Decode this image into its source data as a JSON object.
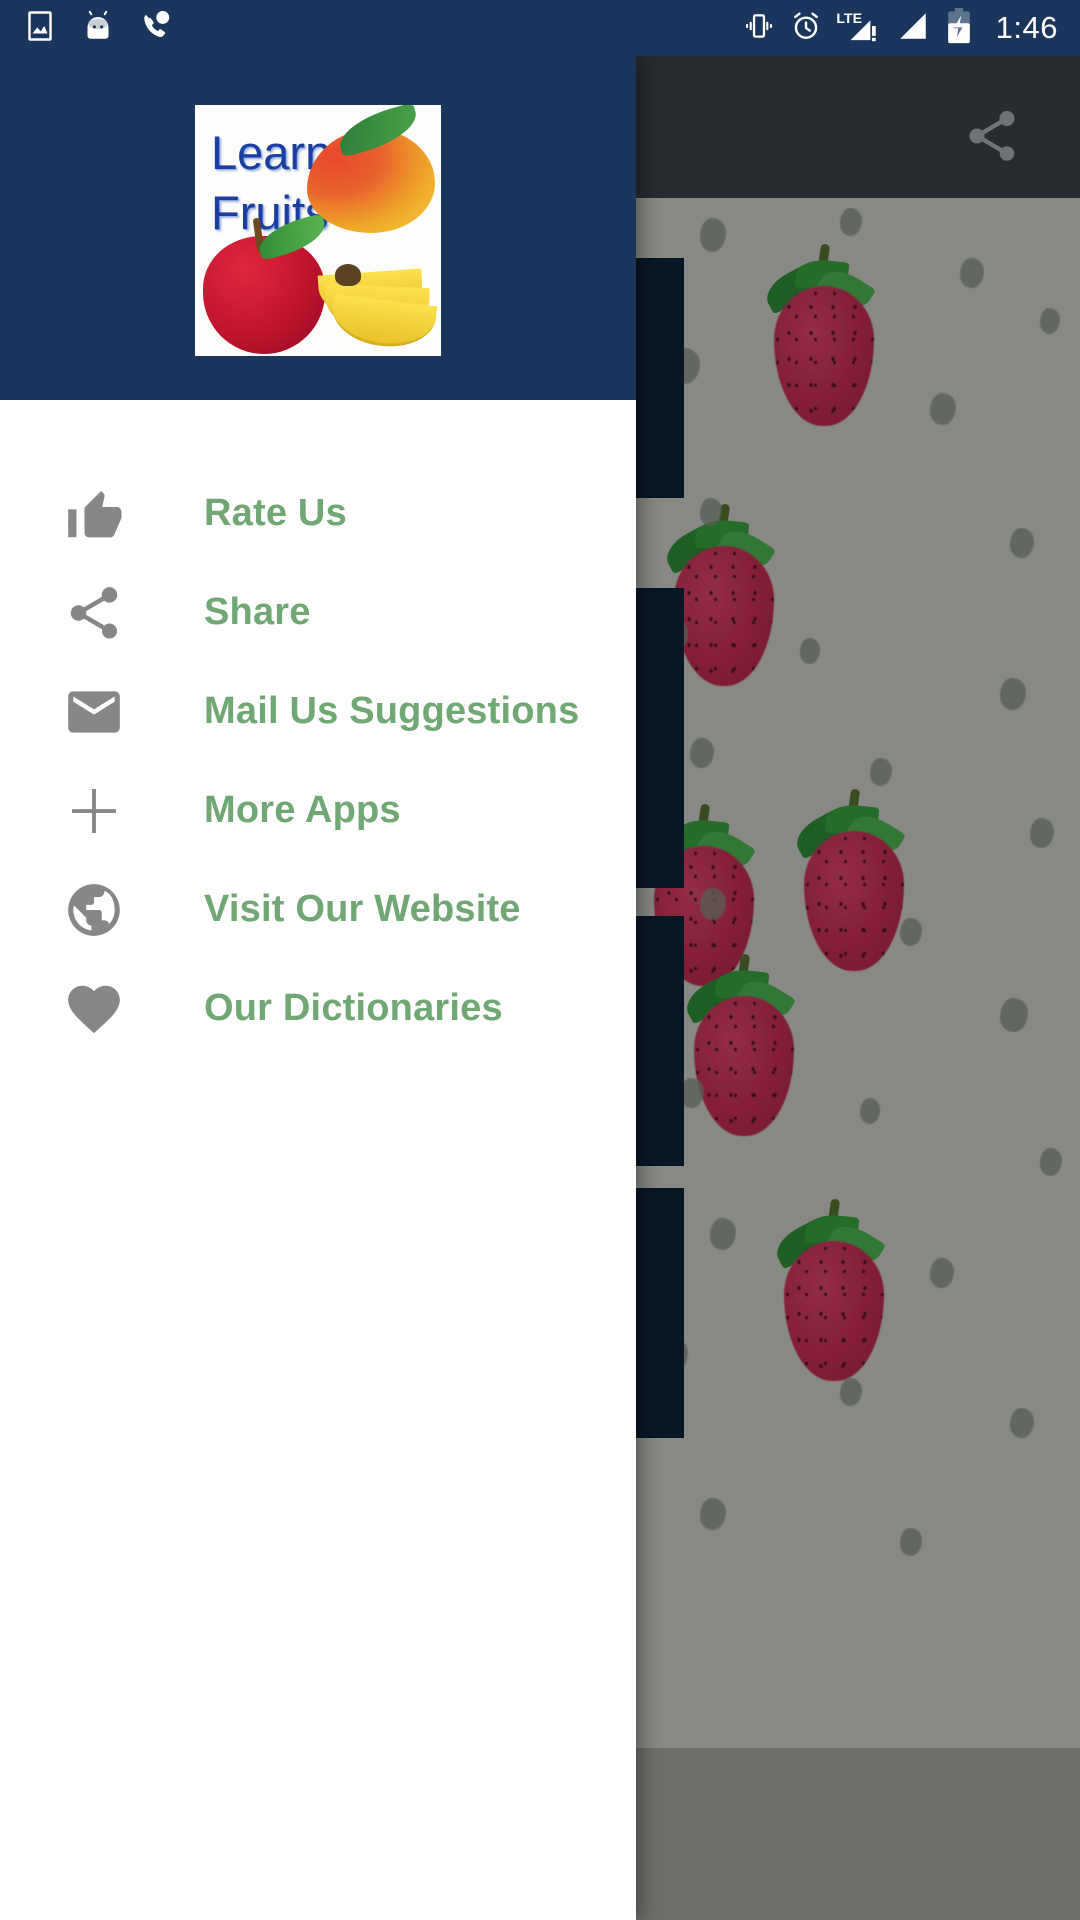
{
  "status_bar": {
    "time": "1:46",
    "background_color": "#1b365d",
    "left_icons": [
      {
        "name": "photo-image-icon",
        "label": "Screenshot"
      },
      {
        "name": "android-bugdroid-icon",
        "label": "Android System"
      },
      {
        "name": "phone-call-icon",
        "label": "Missed call"
      }
    ],
    "right_icons": [
      {
        "name": "vibrate-mode-icon",
        "label": "Vibrate"
      },
      {
        "name": "alarm-clock-icon",
        "label": "Alarm set"
      },
      {
        "name": "lte-signal-warning-icon",
        "label": "LTE"
      },
      {
        "name": "signal-bars-icon",
        "label": "Signal"
      },
      {
        "name": "battery-charging-icon",
        "label": "Charging"
      }
    ]
  },
  "drawer": {
    "header": {
      "background_color": "#1b365d",
      "logo": {
        "name": "learn-fruits-logo",
        "title": "Learn\nFruits",
        "title_color": "#1a3fa0",
        "fruits": [
          "mango",
          "apple",
          "bananas"
        ]
      }
    },
    "accent_text_color": "#6fa873",
    "icon_color": "#878787",
    "items": [
      {
        "icon": "thumbs-up-icon",
        "label": "Rate Us",
        "name": "rate-us"
      },
      {
        "icon": "share-icon",
        "label": "Share",
        "name": "share"
      },
      {
        "icon": "mail-icon",
        "label": "Mail Us Suggestions",
        "name": "mail-us-suggestions"
      },
      {
        "icon": "plus-icon",
        "label": "More Apps",
        "name": "more-apps"
      },
      {
        "icon": "globe-icon",
        "label": "Visit Our Website",
        "name": "visit-our-website"
      },
      {
        "icon": "heart-icon",
        "label": "Our Dictionaries",
        "name": "our-dictionaries"
      }
    ]
  },
  "background_app": {
    "appbar": {
      "background_color": "#3b4249",
      "actions": [
        {
          "icon": "share-icon",
          "name": "share-action"
        }
      ]
    },
    "content": {
      "description": "Strawberry flashcard images on light paper background",
      "background_color": "#c9c9c3"
    },
    "scrim_color": "rgba(0,0,0,0.32)"
  }
}
